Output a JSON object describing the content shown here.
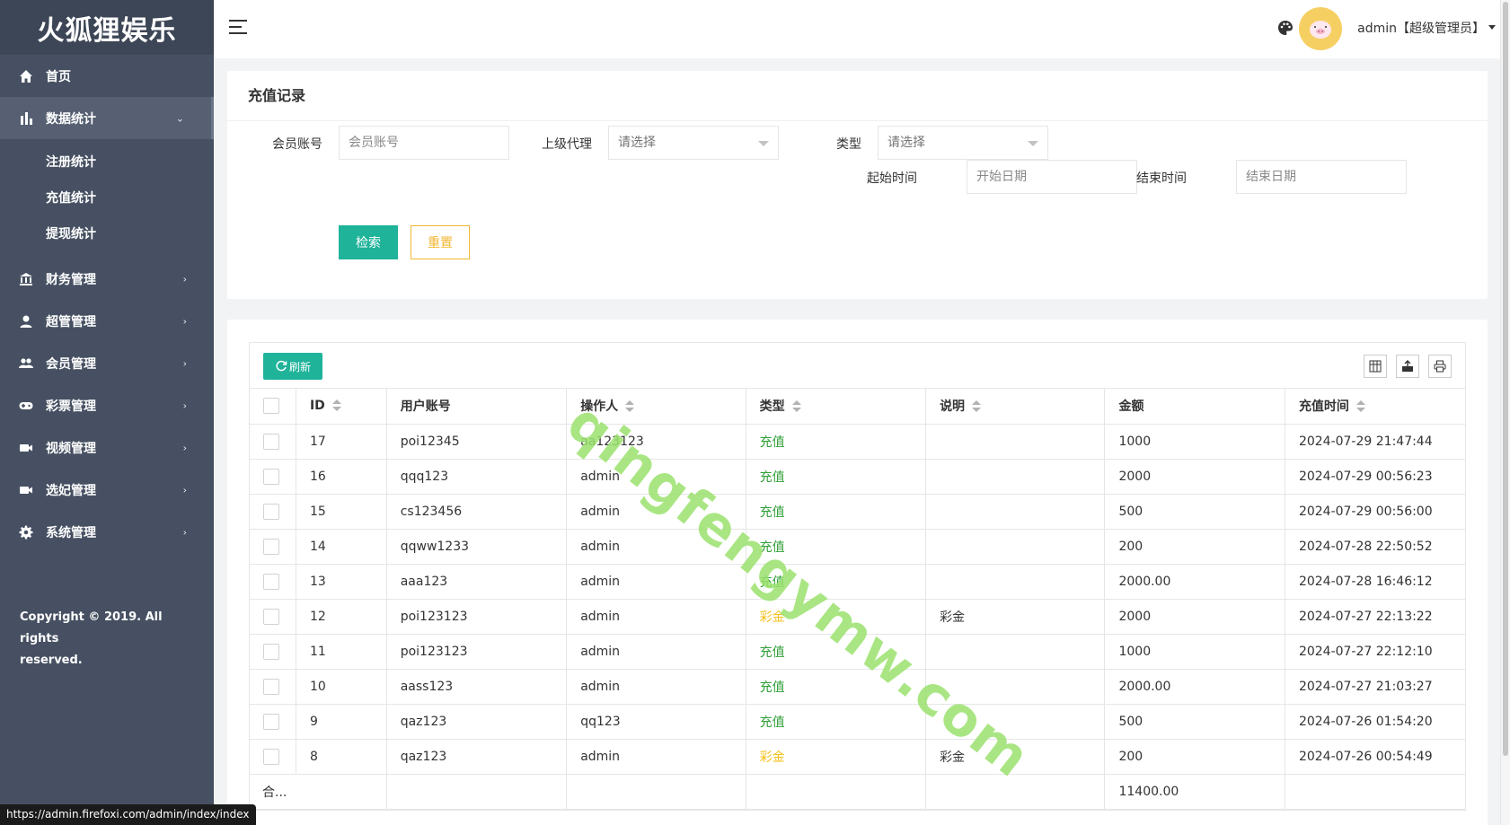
{
  "brand": "火狐狸娱乐",
  "sidebar": {
    "items": [
      {
        "label": "首页"
      },
      {
        "label": "数据统计",
        "sub": [
          "注册统计",
          "充值统计",
          "提现统计"
        ]
      },
      {
        "label": "财务管理"
      },
      {
        "label": "超管管理"
      },
      {
        "label": "会员管理"
      },
      {
        "label": "彩票管理"
      },
      {
        "label": "视频管理"
      },
      {
        "label": "选妃管理"
      },
      {
        "label": "系统管理"
      }
    ],
    "copyright_line1": "Copyright © 2019. All rights",
    "copyright_line2": "reserved."
  },
  "header": {
    "user": "admin【超级管理员】"
  },
  "status_url": "https://admin.firefoxi.com/admin/index/index",
  "watermark": "qingfengymw.com",
  "search": {
    "title": "充值记录",
    "member_label": "会员账号",
    "member_placeholder": "会员账号",
    "agent_label": "上级代理",
    "agent_value": "请选择",
    "type_label": "类型",
    "type_value": "请选择",
    "start_label": "起始时间",
    "start_placeholder": "开始日期",
    "end_label": "结束时间",
    "end_placeholder": "结束日期",
    "search_btn": "检索",
    "reset_btn": "重置"
  },
  "table": {
    "refresh_btn": "刷新",
    "columns": [
      "ID",
      "用户账号",
      "操作人",
      "类型",
      "说明",
      "金额",
      "充值时间"
    ],
    "rows": [
      {
        "id": "17",
        "user": "poi12345",
        "operator": "aa123123",
        "type": "充值",
        "note": "",
        "amount": "1000",
        "time": "2024-07-29 21:47:44"
      },
      {
        "id": "16",
        "user": "qqq123",
        "operator": "admin",
        "type": "充值",
        "note": "",
        "amount": "2000",
        "time": "2024-07-29 00:56:23"
      },
      {
        "id": "15",
        "user": "cs123456",
        "operator": "admin",
        "type": "充值",
        "note": "",
        "amount": "500",
        "time": "2024-07-29 00:56:00"
      },
      {
        "id": "14",
        "user": "qqww1233",
        "operator": "admin",
        "type": "充值",
        "note": "",
        "amount": "200",
        "time": "2024-07-28 22:50:52"
      },
      {
        "id": "13",
        "user": "aaa123",
        "operator": "admin",
        "type": "充值",
        "note": "",
        "amount": "2000.00",
        "time": "2024-07-28 16:46:12"
      },
      {
        "id": "12",
        "user": "poi123123",
        "operator": "admin",
        "type": "彩金",
        "note": "彩金",
        "amount": "2000",
        "time": "2024-07-27 22:13:22"
      },
      {
        "id": "11",
        "user": "poi123123",
        "operator": "admin",
        "type": "充值",
        "note": "",
        "amount": "1000",
        "time": "2024-07-27 22:12:10"
      },
      {
        "id": "10",
        "user": "aass123",
        "operator": "admin",
        "type": "充值",
        "note": "",
        "amount": "2000.00",
        "time": "2024-07-27 21:03:27"
      },
      {
        "id": "9",
        "user": "qaz123",
        "operator": "qq123",
        "type": "充值",
        "note": "",
        "amount": "500",
        "time": "2024-07-26 01:54:20"
      },
      {
        "id": "8",
        "user": "qaz123",
        "operator": "admin",
        "type": "彩金",
        "note": "彩金",
        "amount": "200",
        "time": "2024-07-26 00:54:49"
      }
    ],
    "total_label": "合...",
    "total_amount": "11400.00"
  },
  "colors": {
    "sidebar_bg": "#465062",
    "primary": "#1fb39a",
    "reset": "#f2b632",
    "type_recharge": "#2e9e36",
    "type_bonus": "#f5bf1a"
  }
}
